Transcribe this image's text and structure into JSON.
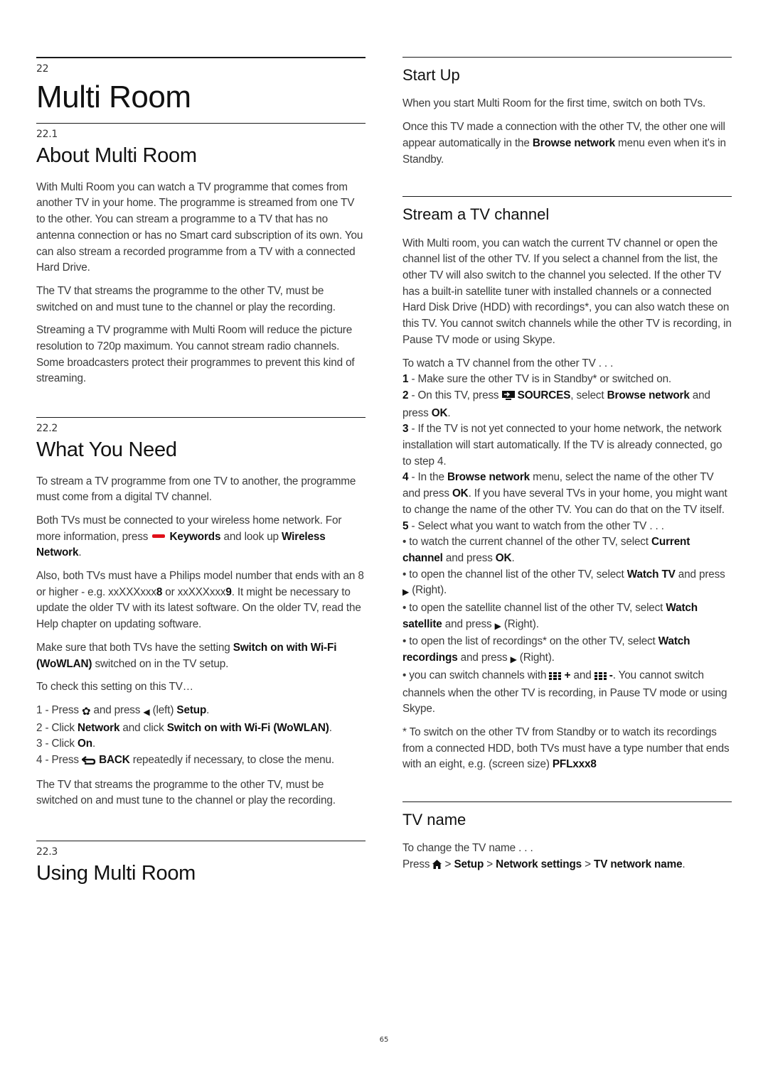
{
  "chapter": {
    "number": "22",
    "title": "Multi Room"
  },
  "sections": {
    "about": {
      "number": "22.1",
      "title": "About Multi Room",
      "paragraphs": [
        "With Multi Room you can watch a TV programme that comes from another TV in your home. The programme is streamed from one TV to the other. You can stream a programme to a TV that has no antenna connection or has no Smart card subscription of its own. You can also stream a recorded programme from a TV with a connected Hard Drive.",
        "The TV that streams the programme to the other TV, must be switched on and must tune to the channel or play the recording.",
        "Streaming a TV programme with Multi Room will reduce the picture resolution to 720p maximum. You cannot stream radio channels. Some broadcasters protect their programmes to prevent this kind of streaming."
      ]
    },
    "need": {
      "number": "22.2",
      "title": "What You Need",
      "p1": "To stream a TV programme from one TV to another, the programme must come from a digital TV channel.",
      "p2_a": "Both TVs must be connected to your wireless home network. For more information, press ",
      "p2_key": "Keywords",
      "p2_b": " and look up ",
      "p2_term": "Wireless Network",
      "p2_c": ".",
      "p3_a": "Also, both TVs must have a Philips model number that ends with an 8 or higher - e.g. xxXXXxxx",
      "p3_n1": "8",
      "p3_b": " or xxXXXxxx",
      "p3_n2": "9",
      "p3_c": ". It might be necessary to update the older TV with its latest software. On the older TV, read the Help chapter on updating software.",
      "p4_a": "Make sure that both TVs have the setting ",
      "p4_term": "Switch on with Wi-Fi (WoWLAN)",
      "p4_b": " switched on in the TV setup.",
      "p5": "To check this setting on this TV…",
      "steps": {
        "s1_a": "1 - Press ",
        "s1_b": " and press ",
        "s1_c": " (left) ",
        "s1_term": "Setup",
        "s1_d": ".",
        "s2_a": "2 - Click ",
        "s2_term1": "Network",
        "s2_b": " and click ",
        "s2_term2": "Switch on with Wi-Fi (WoWLAN)",
        "s2_c": ".",
        "s3_a": "3 - Click ",
        "s3_term": "On",
        "s3_b": ".",
        "s4_a": "4 - Press ",
        "s4_term": "BACK",
        "s4_b": " repeatedly if necessary, to close the menu."
      },
      "p6": "The TV that streams the programme to the other TV, must be switched on and must tune to the channel or play the recording."
    },
    "using": {
      "number": "22.3",
      "title": "Using Multi Room"
    },
    "startup": {
      "title": "Start Up",
      "p1": "When you start Multi Room for the first time, switch on both TVs.",
      "p2_a": "Once this TV made a connection with the other TV, the other one will appear automatically in the ",
      "p2_term": "Browse network",
      "p2_b": " menu even when it's in Standby."
    },
    "stream": {
      "title": "Stream a TV channel",
      "p1": " With Multi room, you can watch the current TV channel or open the channel list of the other TV. If you select a channel from the list, the other TV will also switch to the channel you selected. If the other TV has a built-in satellite tuner with installed channels or a connected Hard Disk Drive (HDD) with recordings*, you can also watch these on this TV. You cannot switch channels while the other TV is recording, in Pause TV mode or using Skype.",
      "intro": "To watch a TV channel from the other TV . . .",
      "step1_n": "1",
      "step1": " - Make sure the other TV is in Standby* or switched on.",
      "step2_n": "2",
      "step2_a": " - On this TV, press ",
      "step2_key": "SOURCES",
      "step2_b": ", select ",
      "step2_term": "Browse network",
      "step2_c": " and press ",
      "step2_ok": "OK",
      "step2_d": ".",
      "step3_n": "3",
      "step3": " - If the TV is not yet connected to your home network, the network installation will start automatically. If the TV is already connected, go to step 4.",
      "step4_n": "4",
      "step4_a": " - In the ",
      "step4_term": "Browse network",
      "step4_b": " menu, select the name of the other TV and press ",
      "step4_ok": "OK",
      "step4_c": ". If you have several TVs in your home, you might want to change the name of the other TV. You can do that on the TV itself.",
      "step5_n": "5",
      "step5": " - Select what you want to watch from the other TV . . .",
      "b1_a": "• to watch the current channel of the other TV, select ",
      "b1_term": "Current channel",
      "b1_b": " and press ",
      "b1_ok": "OK",
      "b1_c": ".",
      "b2_a": "• to open the channel list of the other TV, select ",
      "b2_term": "Watch TV",
      "b2_b": " and press ",
      "b2_c": " (Right).",
      "b3_a": "• to open the satellite channel list of the other TV, select ",
      "b3_term": "Watch satellite",
      "b3_b": " and press ",
      "b3_c": " (Right).",
      "b4_a": "• to open the list of recordings* on the other TV, select ",
      "b4_term": "Watch recordings",
      "b4_b": " and press ",
      "b4_c": " (Right).",
      "b5_a": "• you can switch channels with ",
      "b5_plus": "+",
      "b5_b": " and ",
      "b5_minus": "-",
      "b5_c": ". You cannot switch channels when the other TV is recording, in Pause TV mode or using Skype.",
      "note_a": "* To switch on the other TV from Standby or to watch its recordings from a connected HDD, both TVs must have a type number that ends with an eight, e.g. (screen size) ",
      "note_term": "PFLxxx8"
    },
    "tvname": {
      "title": "TV name",
      "p1": "To change the TV name . . .",
      "p2_a": "Press ",
      "sep": " > ",
      "path1": "Setup",
      "path2": "Network settings",
      "path3": "TV network name",
      "p2_end": "."
    }
  },
  "footer": {
    "page_number": "65"
  },
  "colors": {
    "red_key": "#e0101a",
    "heading": "#111111",
    "body_text": "#3a3a3a"
  },
  "icons": {
    "red_key": "red-color-key-icon",
    "settings": "gear-icon",
    "left": "triangle-left-icon",
    "back": "back-arrow-icon",
    "sources": "sources-icon",
    "right": "triangle-right-icon",
    "channel_list": "channel-list-icon",
    "home": "home-icon"
  }
}
